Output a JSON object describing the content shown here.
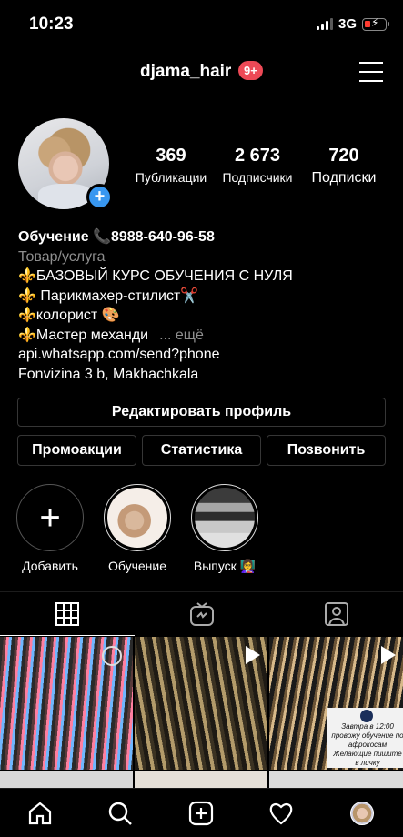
{
  "status_bar": {
    "time": "10:23",
    "network": "3G"
  },
  "header": {
    "username": "djama_hair",
    "notifications_badge": "9+"
  },
  "stats": [
    {
      "value": "369",
      "label": "Публикации"
    },
    {
      "value": "2 673",
      "label": "Подписчики"
    },
    {
      "value": "720",
      "label": "Подписки"
    }
  ],
  "bio": {
    "name": "Обучение 📞8988-640-96-58",
    "category": "Товар/услуга",
    "lines": [
      "⚜️БАЗОВЫЙ КУРС ОБУЧЕНИЯ С НУЛЯ",
      "⚜️ Парикмахер-стилист✂️",
      "⚜️колорист 🎨",
      "⚜️Мастер механди"
    ],
    "more": "... ещё",
    "link": "api.whatsapp.com/send?phone",
    "address": "Fonvizina 3 b, Makhachkala"
  },
  "buttons": {
    "edit_profile": "Редактировать профиль",
    "promotions": "Промоакции",
    "statistics": "Статистика",
    "call": "Позвонить"
  },
  "highlights": [
    {
      "label": "Добавить",
      "icon": "plus-icon"
    },
    {
      "label": "Обучение"
    },
    {
      "label": "Выпуск 👩‍🏫"
    }
  ],
  "tabs": [
    {
      "name": "posts-grid",
      "icon": "grid-icon"
    },
    {
      "name": "igtv",
      "icon": "igtv-icon"
    },
    {
      "name": "tagged",
      "icon": "tagged-person-icon"
    }
  ],
  "grid_posts": [
    {
      "type": "image"
    },
    {
      "type": "video"
    },
    {
      "type": "video",
      "caption": "Завтра в 12:00 провожу обучение по афрокосам Желающие пишите в личку"
    }
  ],
  "bottom_nav": [
    "home-icon",
    "search-icon",
    "new-post-icon",
    "activity-heart-icon",
    "profile-avatar"
  ],
  "colors": {
    "background": "#000000",
    "accent_blue": "#3897f0",
    "badge_red": "#ed4956",
    "muted_text": "#8e8e8e",
    "border": "#363636"
  }
}
